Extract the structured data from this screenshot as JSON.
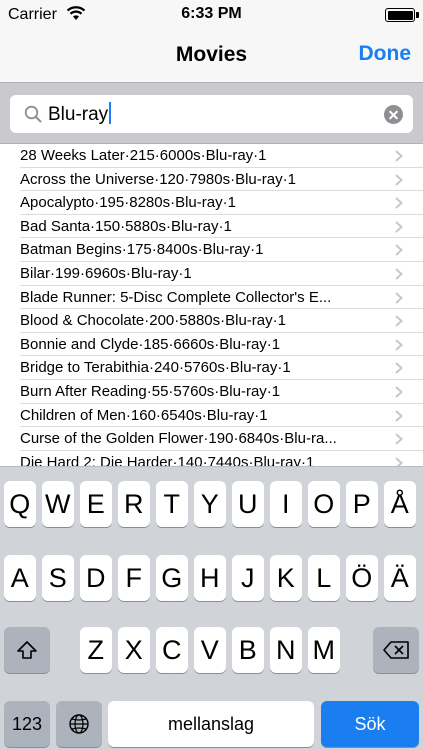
{
  "status_bar": {
    "carrier": "Carrier",
    "time": "6:33 PM",
    "battery_level": 1.0
  },
  "nav": {
    "title": "Movies",
    "done_label": "Done"
  },
  "search": {
    "value": "Blu-ray",
    "icons": {
      "search": "search-icon",
      "clear": "clear-icon"
    }
  },
  "movies": [
    "28 Weeks Later·215·6000s·Blu-ray·1",
    "Across the Universe·120·7980s·Blu-ray·1",
    "Apocalypto·195·8280s·Blu-ray·1",
    "Bad Santa·150·5880s·Blu-ray·1",
    "Batman Begins·175·8400s·Blu-ray·1",
    "Bilar·199·6960s·Blu-ray·1",
    "Blade Runner: 5-Disc Complete Collector's E...",
    "Blood & Chocolate·200·5880s·Blu-ray·1",
    "Bonnie and Clyde·185·6660s·Blu-ray·1",
    "Bridge to Terabithia·240·5760s·Blu-ray·1",
    "Burn After Reading·55·5760s·Blu-ray·1",
    "Children of Men·160·6540s·Blu-ray·1",
    "Curse of the Golden Flower·190·6840s·Blu-ra...",
    "Die Hard 2: Die Harder·140·7440s·Blu-ray·1"
  ],
  "keyboard": {
    "row1": [
      "Q",
      "W",
      "E",
      "R",
      "T",
      "Y",
      "U",
      "I",
      "O",
      "P",
      "Å"
    ],
    "row2": [
      "A",
      "S",
      "D",
      "F",
      "G",
      "H",
      "J",
      "K",
      "L",
      "Ö",
      "Ä"
    ],
    "row3": [
      "Z",
      "X",
      "C",
      "V",
      "B",
      "N",
      "M"
    ],
    "numbers_label": "123",
    "space_label": "mellanslag",
    "search_label": "Sök",
    "accent_color": "#1a7ef0"
  }
}
